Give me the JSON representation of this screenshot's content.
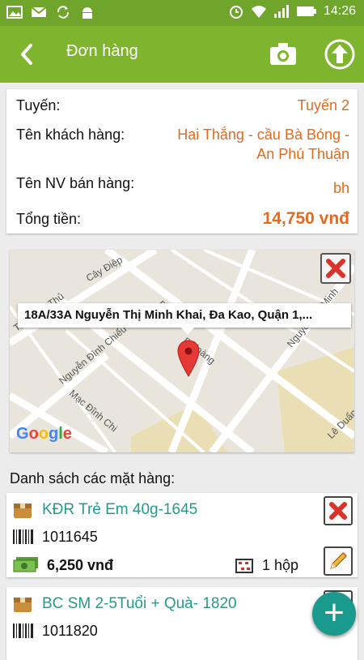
{
  "status_bar": {
    "time": "14:26"
  },
  "app_bar": {
    "title": "Đơn hàng"
  },
  "order": {
    "route_label": "Tuyến:",
    "route_value": "Tuyến 2",
    "customer_label": "Tên khách hàng:",
    "customer_value_line1": "Hai Thắng - cầu Bà Bóng -",
    "customer_value_line2": "An Phú Thuận",
    "seller_label": "Tên NV bán hàng:",
    "seller_value": "bh",
    "total_label": "Tổng tiền:",
    "total_value": "14,750 vnđ"
  },
  "map": {
    "address": "18A/33A Nguyễn Thị Minh Khai, Đa Kao, Quận 1,...",
    "logo": "Google",
    "roads": [
      "Cây Điệp",
      "Trần Văn Thủ",
      "Nguyễn Đình Chiểu",
      "Mạc Đĩnh Chi",
      "n Hoàng",
      "Nguyễn Thị Minh",
      "Lê Duẩn",
      "Đ"
    ]
  },
  "list": {
    "title": "Danh sách các mặt hàng:",
    "items": [
      {
        "name": "KĐR Trẻ Em 40g-1645",
        "code": "1011645",
        "price": "6,250 vnđ",
        "qty": "1 hộp"
      },
      {
        "name": "BC SM  2-5Tuổi + Quà- 1820",
        "code": "1011820"
      }
    ]
  },
  "fab": {
    "label": "+"
  },
  "colors": {
    "status_bar": "#6fa52a",
    "app_bar": "#7fb42f",
    "accent_orange": "#e36a1e",
    "item_teal": "#259a8a",
    "fab": "#1a9a8c"
  }
}
